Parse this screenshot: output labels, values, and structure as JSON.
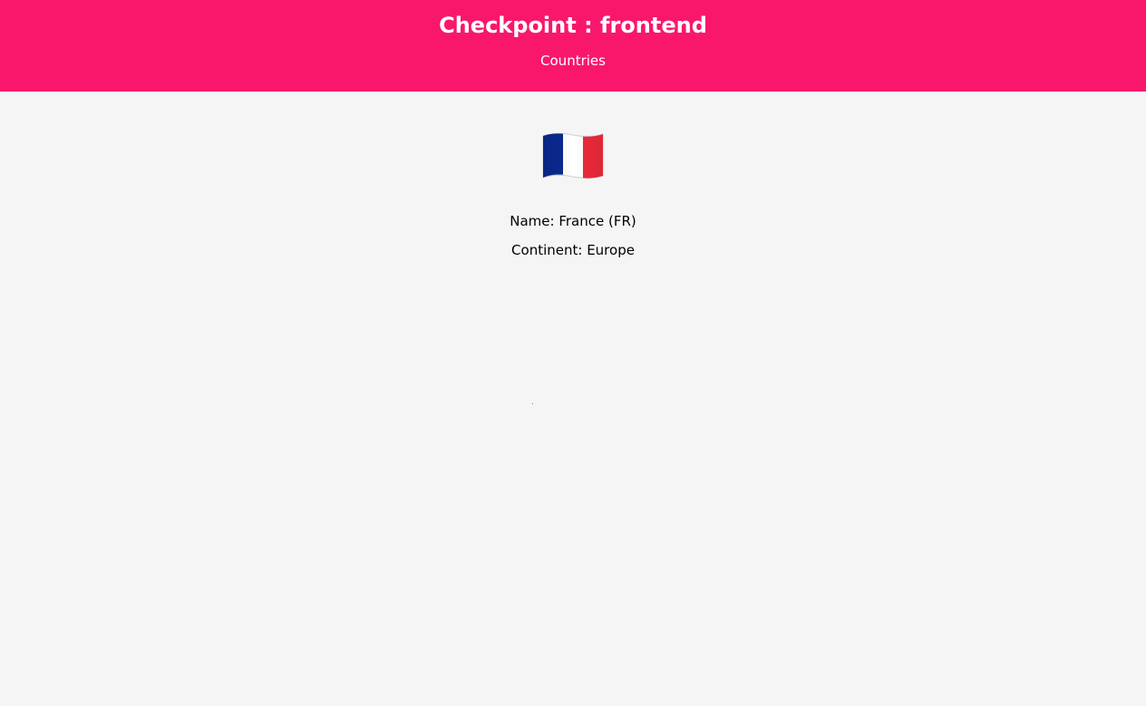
{
  "header": {
    "title": "Checkpoint : frontend",
    "nav": {
      "countries_label": "Countries"
    },
    "background_color": "#f9176c",
    "text_color": "#ffffff"
  },
  "country": {
    "flag": "fr-flag-icon",
    "name_line": "Name: France (FR)",
    "continent_line": "Continent: Europe",
    "flag_colors": [
      "#0a2a8f",
      "#ffffff",
      "#ef2b3c"
    ]
  },
  "page": {
    "background_color": "#f5f5f5"
  }
}
